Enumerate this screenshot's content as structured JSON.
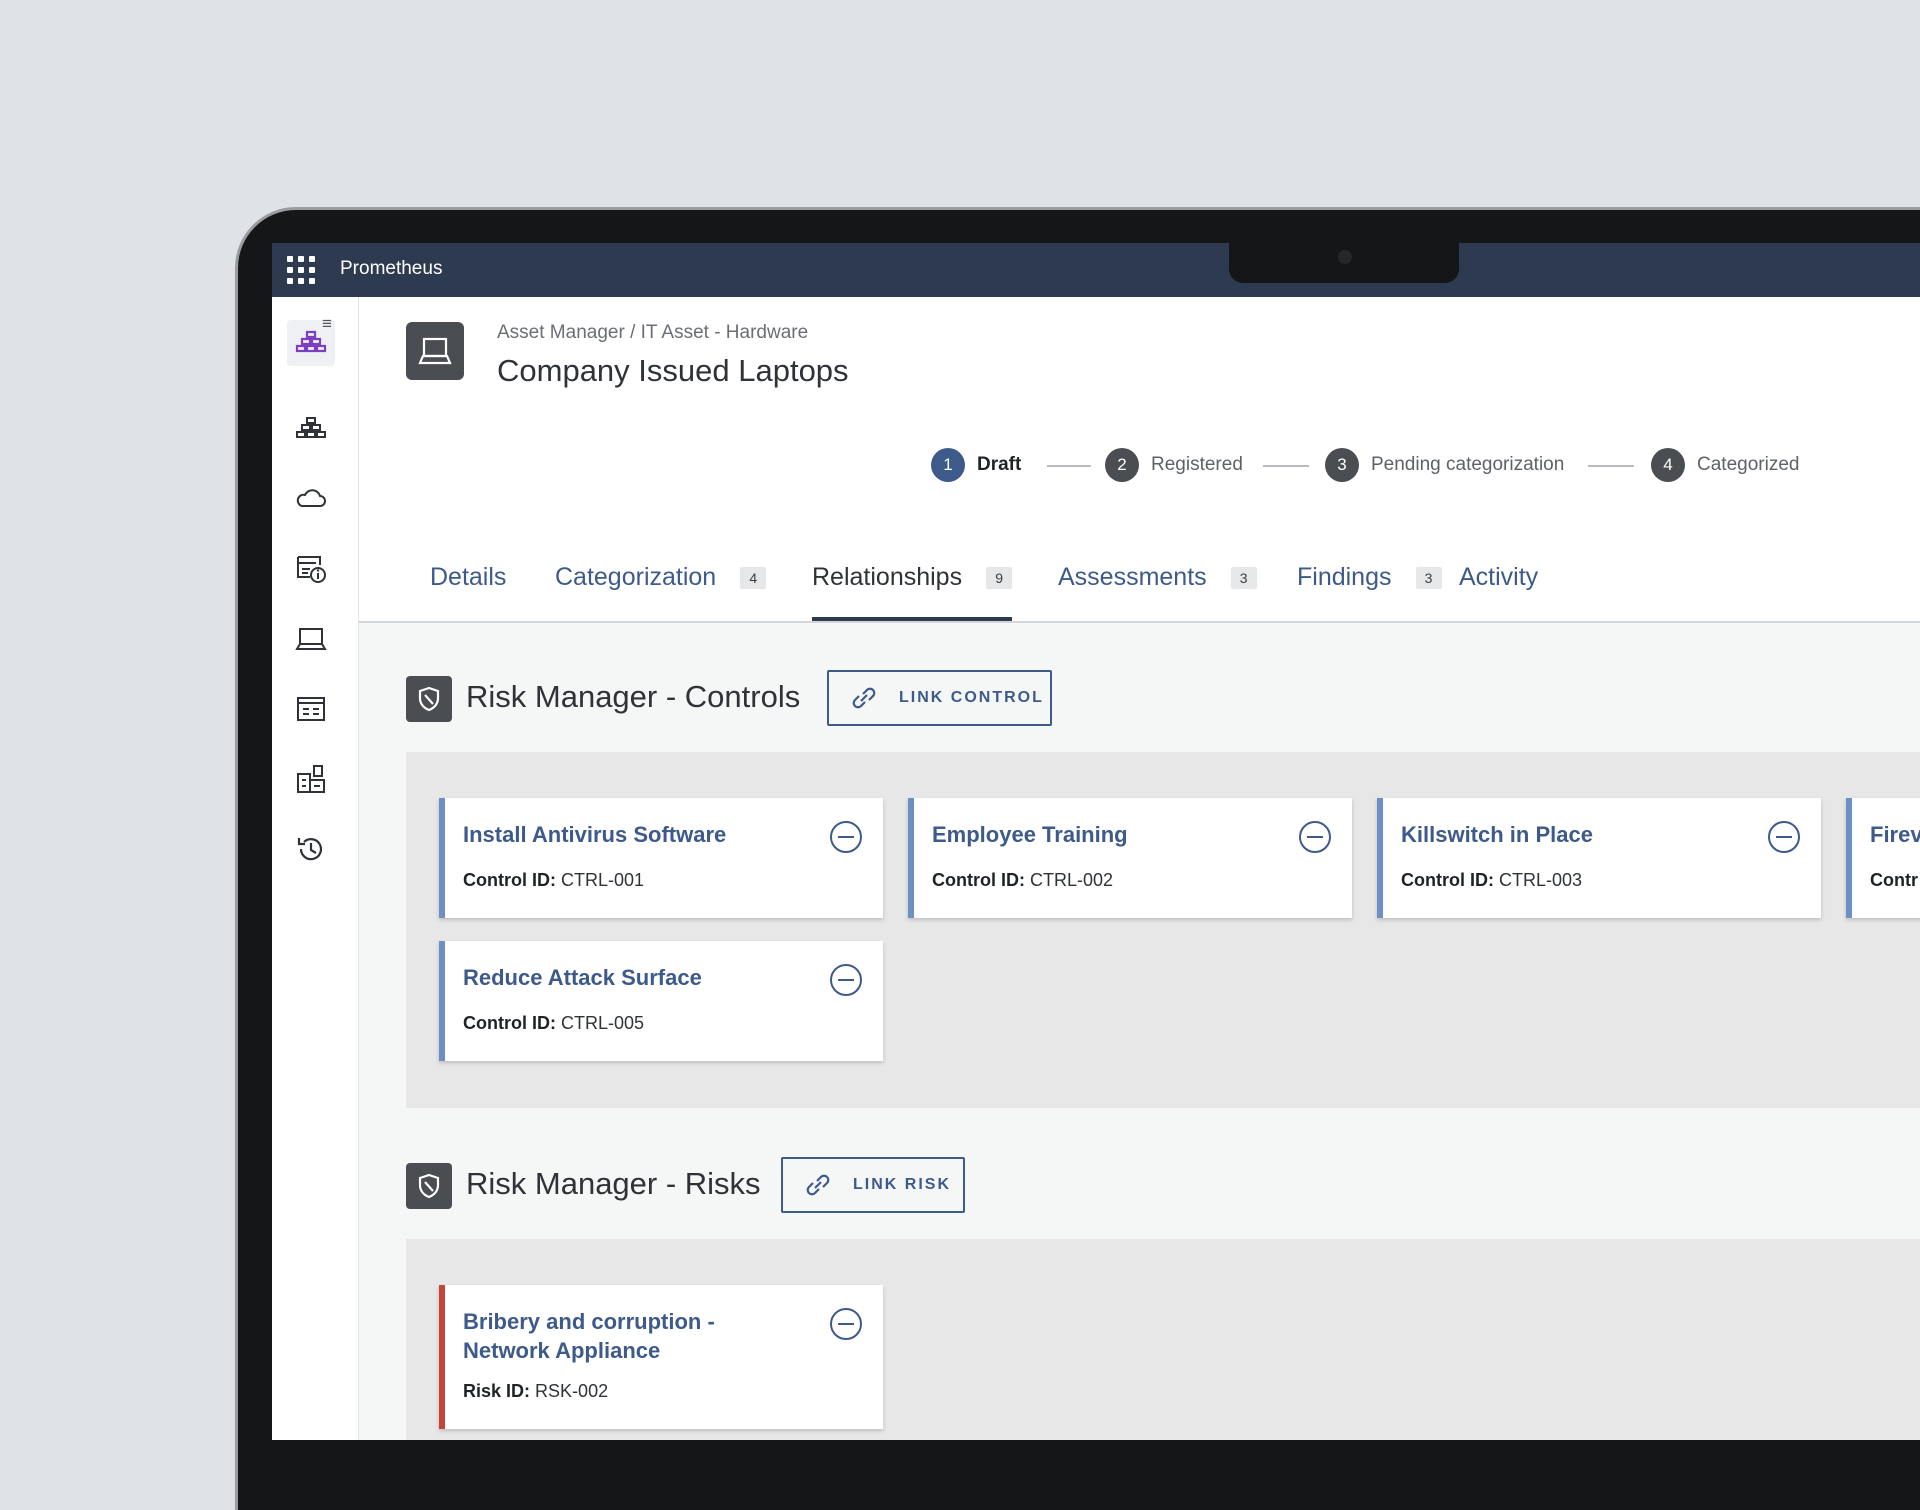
{
  "app": {
    "name": "Prometheus"
  },
  "header": {
    "breadcrumb": "Asset Manager / IT Asset - Hardware",
    "title": "Company Issued Laptops"
  },
  "stepper": [
    {
      "num": "1",
      "label": "Draft",
      "active": true
    },
    {
      "num": "2",
      "label": "Registered",
      "active": false
    },
    {
      "num": "3",
      "label": "Pending categorization",
      "active": false
    },
    {
      "num": "4",
      "label": "Categorized",
      "active": false
    }
  ],
  "tabs": [
    {
      "label": "Details",
      "count": null
    },
    {
      "label": "Categorization",
      "count": "4"
    },
    {
      "label": "Relationships",
      "count": "9",
      "active": true
    },
    {
      "label": "Assessments",
      "count": "3"
    },
    {
      "label": "Findings",
      "count": "3"
    },
    {
      "label": "Activity",
      "count": null
    }
  ],
  "controls_section": {
    "title": "Risk Manager - Controls",
    "button": "LINK CONTROL",
    "meta_label": "Control ID:",
    "cards": [
      {
        "title": "Install Antivirus Software",
        "id": "CTRL-001"
      },
      {
        "title": "Employee Training",
        "id": "CTRL-002"
      },
      {
        "title": "Killswitch in Place",
        "id": "CTRL-003"
      },
      {
        "title": "Firev",
        "id": ""
      },
      {
        "title": "Reduce Attack Surface",
        "id": "CTRL-005"
      }
    ],
    "partial_meta_label": "Contr"
  },
  "risks_section": {
    "title": "Risk Manager - Risks",
    "button": "LINK RISK",
    "meta_label": "Risk ID:",
    "cards": [
      {
        "title": "Bribery and corruption - Network Appliance",
        "id": "RSK-002"
      }
    ]
  },
  "colors": {
    "topbar": "#2d3a4f",
    "accent": "#3d5a8a",
    "control_border": "#6e8fc4",
    "risk_border": "#c7433a"
  }
}
